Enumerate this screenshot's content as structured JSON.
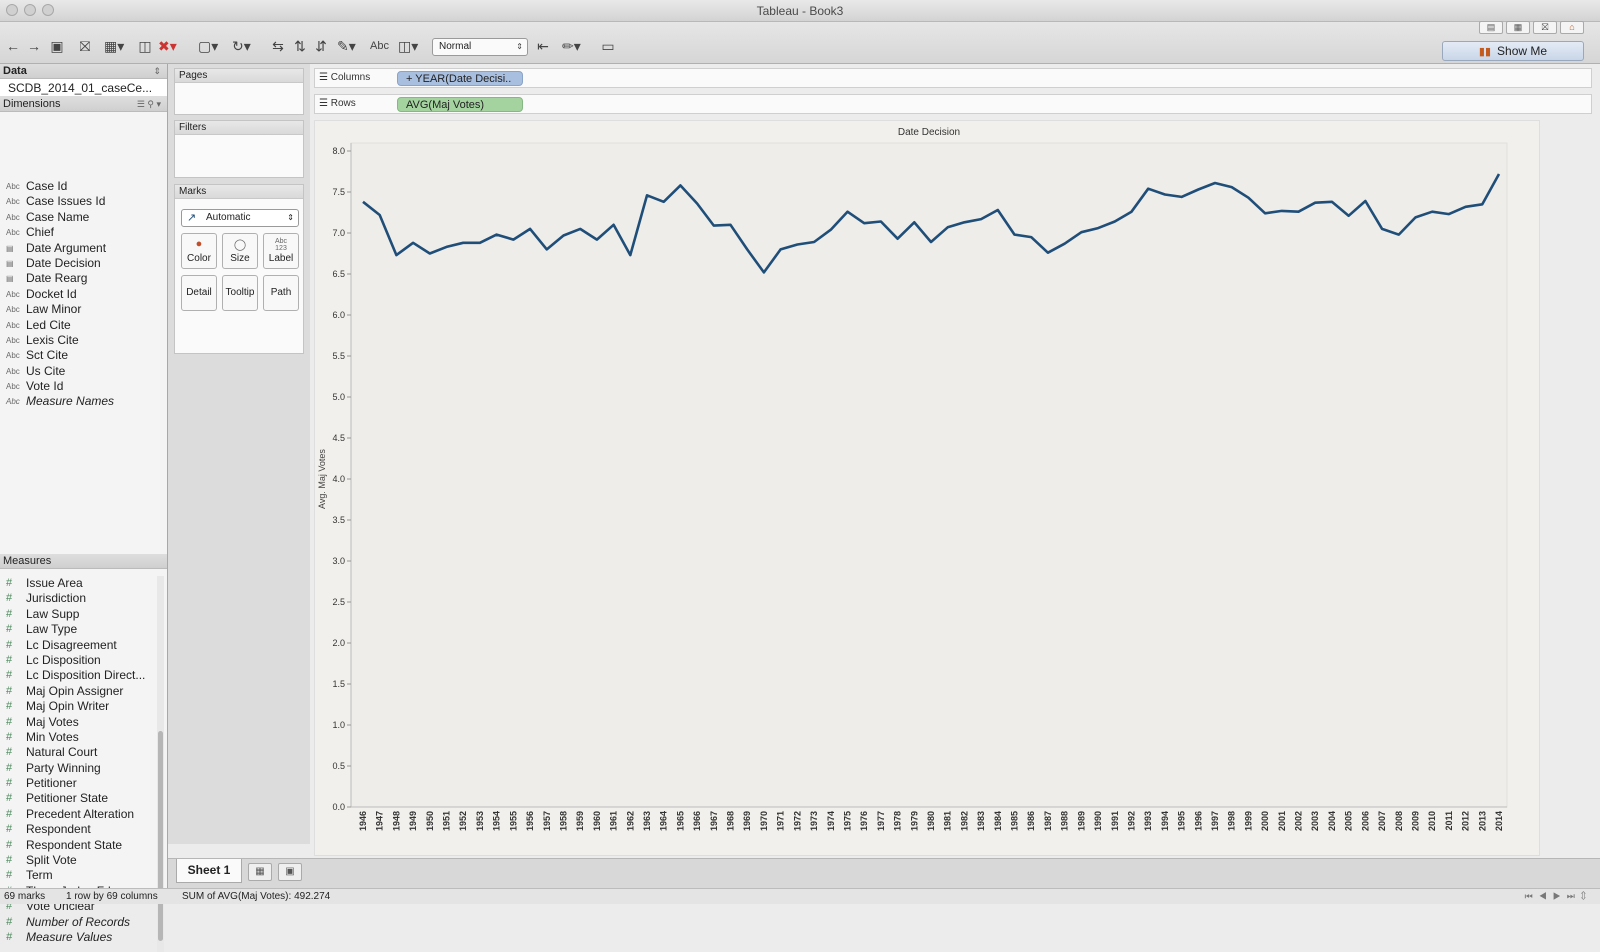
{
  "window": {
    "title": "Tableau - Book3"
  },
  "toolbar": {
    "icons": [
      "back-icon",
      "forward-icon",
      "save-icon",
      "new-datasource-icon",
      "new-sheet-icon",
      "duplicate-sheet-icon",
      "clear-sheet-icon",
      "pause-updates-icon",
      "refresh-icon",
      "swap-axes-icon",
      "sort-ascending-icon",
      "sort-descending-icon",
      "group-icon",
      "text-abc-icon",
      "chart-size-icon",
      "fix-axes-icon",
      "highlight-icon",
      "presentation-icon"
    ],
    "abc_label": "Abc",
    "fit_mode": "Normal",
    "show_me_label": "Show Me"
  },
  "data_pane": {
    "header": "Data",
    "datasource": "SCDB_2014_01_caseCe...",
    "dimensions_header": "Dimensions",
    "dimensions": [
      {
        "label": "Case Id",
        "type": "Abc"
      },
      {
        "label": "Case Issues Id",
        "type": "Abc"
      },
      {
        "label": "Case Name",
        "type": "Abc"
      },
      {
        "label": "Chief",
        "type": "Abc"
      },
      {
        "label": "Date Argument",
        "type": "date"
      },
      {
        "label": "Date Decision",
        "type": "date"
      },
      {
        "label": "Date Rearg",
        "type": "date"
      },
      {
        "label": "Docket Id",
        "type": "Abc"
      },
      {
        "label": "Law Minor",
        "type": "Abc"
      },
      {
        "label": "Led Cite",
        "type": "Abc"
      },
      {
        "label": "Lexis Cite",
        "type": "Abc"
      },
      {
        "label": "Sct Cite",
        "type": "Abc"
      },
      {
        "label": "Us Cite",
        "type": "Abc"
      },
      {
        "label": "Vote Id",
        "type": "Abc"
      },
      {
        "label": "Measure Names",
        "type": "Abc",
        "italic": true
      }
    ],
    "measures_header": "Measures",
    "measures": [
      {
        "label": "Issue Area"
      },
      {
        "label": "Jurisdiction"
      },
      {
        "label": "Law Supp"
      },
      {
        "label": "Law Type"
      },
      {
        "label": "Lc Disagreement"
      },
      {
        "label": "Lc Disposition"
      },
      {
        "label": "Lc Disposition Direct..."
      },
      {
        "label": "Maj Opin Assigner"
      },
      {
        "label": "Maj Opin Writer"
      },
      {
        "label": "Maj Votes"
      },
      {
        "label": "Min Votes"
      },
      {
        "label": "Natural Court"
      },
      {
        "label": "Party Winning"
      },
      {
        "label": "Petitioner"
      },
      {
        "label": "Petitioner State"
      },
      {
        "label": "Precedent Alteration"
      },
      {
        "label": "Respondent"
      },
      {
        "label": "Respondent State"
      },
      {
        "label": "Split Vote"
      },
      {
        "label": "Term"
      },
      {
        "label": "Three Judge Fdc"
      },
      {
        "label": "Vote Unclear"
      },
      {
        "label": "Number of Records",
        "italic": true
      },
      {
        "label": "Measure Values",
        "italic": true
      }
    ]
  },
  "cards": {
    "pages": "Pages",
    "filters": "Filters",
    "marks": "Marks",
    "marks_type": "Automatic",
    "buttons": {
      "color": "Color",
      "size": "Size",
      "label": "Label",
      "label_icon_top": "Abc",
      "label_icon_bottom": "123",
      "detail": "Detail",
      "tooltip": "Tooltip",
      "path": "Path"
    }
  },
  "shelves": {
    "columns_label": "Columns",
    "columns_pill": "YEAR(Date Decisi..",
    "columns_pill_expand": "+",
    "rows_label": "Rows",
    "rows_pill": "AVG(Maj Votes)"
  },
  "chart_data": {
    "type": "line",
    "title": "Date Decision",
    "xlabel": "",
    "ylabel": "Avg. Maj Votes",
    "ylim": [
      0,
      8
    ],
    "yticks": [
      "0.0",
      "0.5",
      "1.0",
      "1.5",
      "2.0",
      "2.5",
      "3.0",
      "3.5",
      "4.0",
      "4.5",
      "5.0",
      "5.5",
      "6.0",
      "6.5",
      "7.0",
      "7.5",
      "8.0"
    ],
    "line_color": "#1f4e79",
    "grid": false,
    "x": [
      1946,
      1947,
      1948,
      1949,
      1950,
      1951,
      1952,
      1953,
      1954,
      1955,
      1956,
      1957,
      1958,
      1959,
      1960,
      1961,
      1962,
      1963,
      1964,
      1965,
      1966,
      1967,
      1968,
      1969,
      1970,
      1971,
      1972,
      1973,
      1974,
      1975,
      1976,
      1977,
      1978,
      1979,
      1980,
      1981,
      1982,
      1983,
      1984,
      1985,
      1986,
      1987,
      1988,
      1989,
      1990,
      1991,
      1992,
      1993,
      1994,
      1995,
      1996,
      1997,
      1998,
      1999,
      2000,
      2001,
      2002,
      2003,
      2004,
      2005,
      2006,
      2007,
      2008,
      2009,
      2010,
      2011,
      2012,
      2013,
      2014
    ],
    "series": [
      {
        "values": [
          7.38,
          7.22,
          6.73,
          6.88,
          6.75,
          6.83,
          6.88,
          6.88,
          6.98,
          6.92,
          7.05,
          6.8,
          6.97,
          7.05,
          6.92,
          7.1,
          6.73,
          7.46,
          7.38,
          7.58,
          7.36,
          7.09,
          7.1,
          6.8,
          6.52,
          6.8,
          6.86,
          6.89,
          7.04,
          7.26,
          7.12,
          7.14,
          6.93,
          7.13,
          6.89,
          7.07,
          7.13,
          7.17,
          7.28,
          6.98,
          6.95,
          6.76,
          6.87,
          7.01,
          7.06,
          7.14,
          7.26,
          7.54,
          7.47,
          7.44,
          7.53,
          7.61,
          7.56,
          7.43,
          7.24,
          7.27,
          7.26,
          7.37,
          7.38,
          7.21,
          7.39,
          7.05,
          6.98,
          7.19,
          7.26,
          7.23,
          7.32,
          7.35,
          7.72
        ]
      }
    ]
  },
  "sheet_tabs": {
    "active": "Sheet 1"
  },
  "status": {
    "marks": "69 marks",
    "dims": "1 row by 69 columns",
    "sum": "SUM of AVG(Maj Votes): 492.274"
  }
}
